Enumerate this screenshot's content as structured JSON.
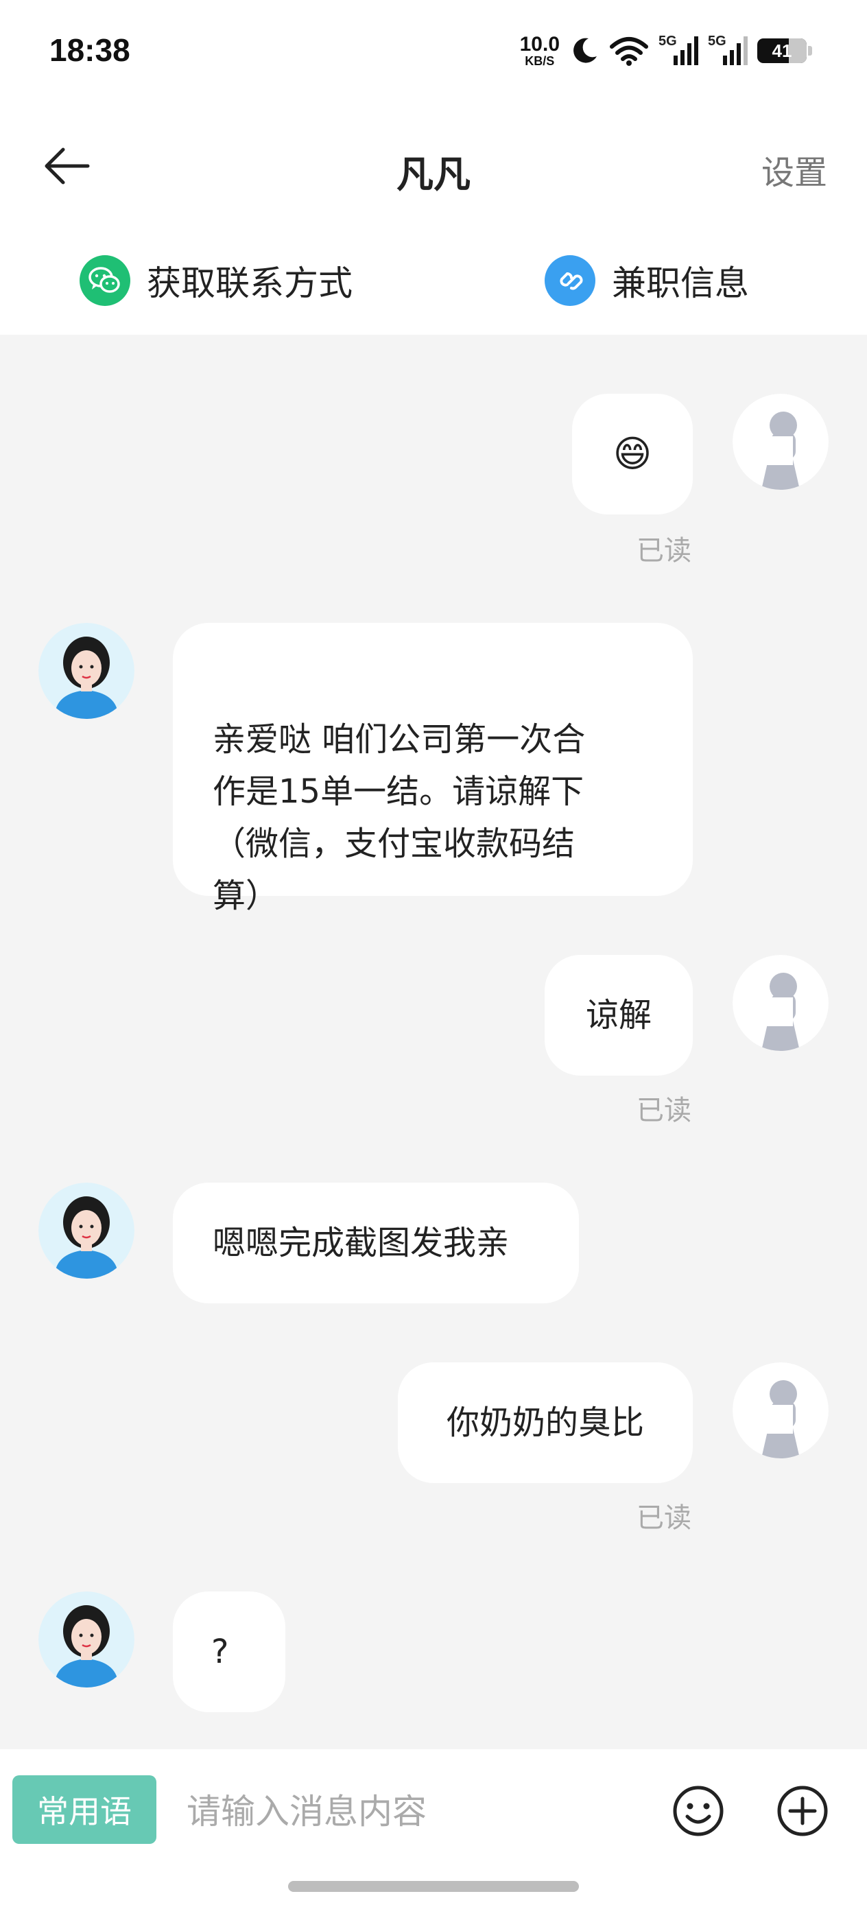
{
  "status": {
    "time": "18:38",
    "net_speed": "10.0",
    "net_unit": "KB/S",
    "signal1": "5G",
    "signal2": "5G",
    "battery": "41"
  },
  "header": {
    "title": "凡凡",
    "settings_label": "设置"
  },
  "quick_actions": [
    {
      "label": "获取联系方式",
      "icon": "wechat-icon",
      "color": "#1fbf74"
    },
    {
      "label": "兼职信息",
      "icon": "link-icon",
      "color": "#3aa0f0"
    }
  ],
  "messages": [
    {
      "from": "me",
      "text": "😄",
      "status": "已读"
    },
    {
      "from": "other",
      "text": "亲爱哒 咱们公司第一次合\n作是15单一结。请谅解下\n（微信，支付宝收款码结\n算）"
    },
    {
      "from": "me",
      "text": "谅解",
      "status": "已读"
    },
    {
      "from": "other",
      "text": "嗯嗯完成截图发我亲"
    },
    {
      "from": "me",
      "text": "你奶奶的臭比",
      "status": "已读"
    },
    {
      "from": "other",
      "text": "?"
    }
  ],
  "input": {
    "phrases_label": "常用语",
    "placeholder": "请输入消息内容",
    "emoji_icon": "smiley-icon",
    "plus_icon": "plus-circle-icon"
  },
  "colors": {
    "accent": "#67c9b4",
    "wechat": "#1fbf74",
    "link": "#3aa0f0",
    "background": "#f4f4f4"
  }
}
